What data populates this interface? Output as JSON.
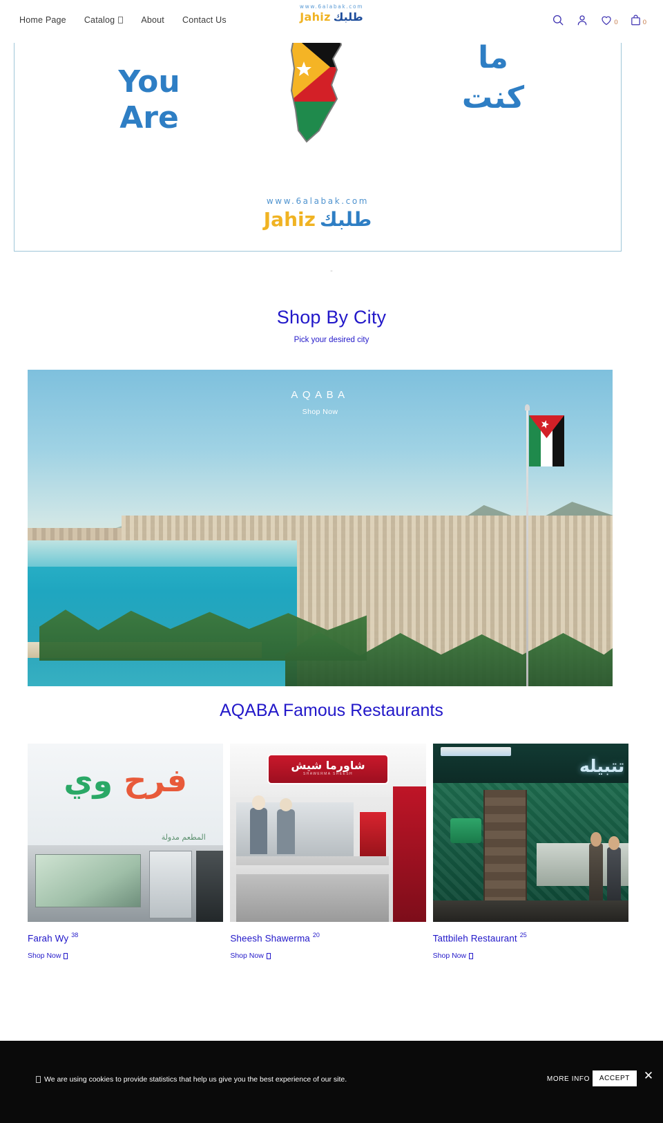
{
  "header": {
    "nav": [
      {
        "label": "Home Page",
        "has_caret": false
      },
      {
        "label": "Catalog",
        "has_caret": true
      },
      {
        "label": "About",
        "has_caret": false
      },
      {
        "label": "Contact Us",
        "has_caret": false
      }
    ],
    "logo": {
      "url": "www.6alabak.com",
      "brand_en": "Jahiz",
      "brand_ar": "طلبك"
    },
    "icons": {
      "search": "search-icon",
      "account": "account-icon",
      "wishlist": "heart-icon",
      "wishlist_count": "0",
      "cart": "bag-icon",
      "cart_count": "0"
    }
  },
  "hero": {
    "left_text": "You\nAre",
    "left_line1": "You",
    "left_line2": "Are",
    "right_line1": "ما",
    "right_line2": "كنت",
    "footer_url": "www.6alabak.com",
    "footer_brand_en": "Jahiz",
    "footer_brand_ar": "طلبك",
    "map_alt": "jordan-flag-map",
    "carousel_dot": "-"
  },
  "shop_by_city": {
    "title": "Shop By City",
    "subtitle": "Pick your desired city",
    "banner": {
      "city": "AQABA",
      "cta": "Shop Now",
      "photo_alt": "aqaba-city-skyline-with-flag"
    }
  },
  "restaurants": {
    "title": "AQABA Famous Restaurants",
    "cards": [
      {
        "name": "Farah Wy",
        "count": "38",
        "cta": "Shop Now",
        "arabic_sign": "فرح وي",
        "arabic_sub": "المطعم مدولة"
      },
      {
        "name": "Sheesh Shawerma",
        "count": "20",
        "cta": "Shop Now",
        "arabic_sign": "شاورما شيش",
        "sign_sub": "SHAWERMA SHEESH"
      },
      {
        "name": "Tattbileh Restaurant",
        "count": "25",
        "cta": "Shop Now",
        "arabic_sign": "تتبيله"
      }
    ]
  },
  "cookie_bar": {
    "message": "We are using cookies to provide statistics that help us give you the best experience of our site.",
    "more_info": "MORE INFO",
    "accept": "ACCEPT",
    "close": "✕"
  },
  "colors": {
    "brand_blue": "#2218c9",
    "logo_yellow": "#f0b323",
    "logo_blue": "#2e7ec4",
    "nav_text": "#3a3a3a",
    "cookie_bg": "#0a0a0a"
  }
}
